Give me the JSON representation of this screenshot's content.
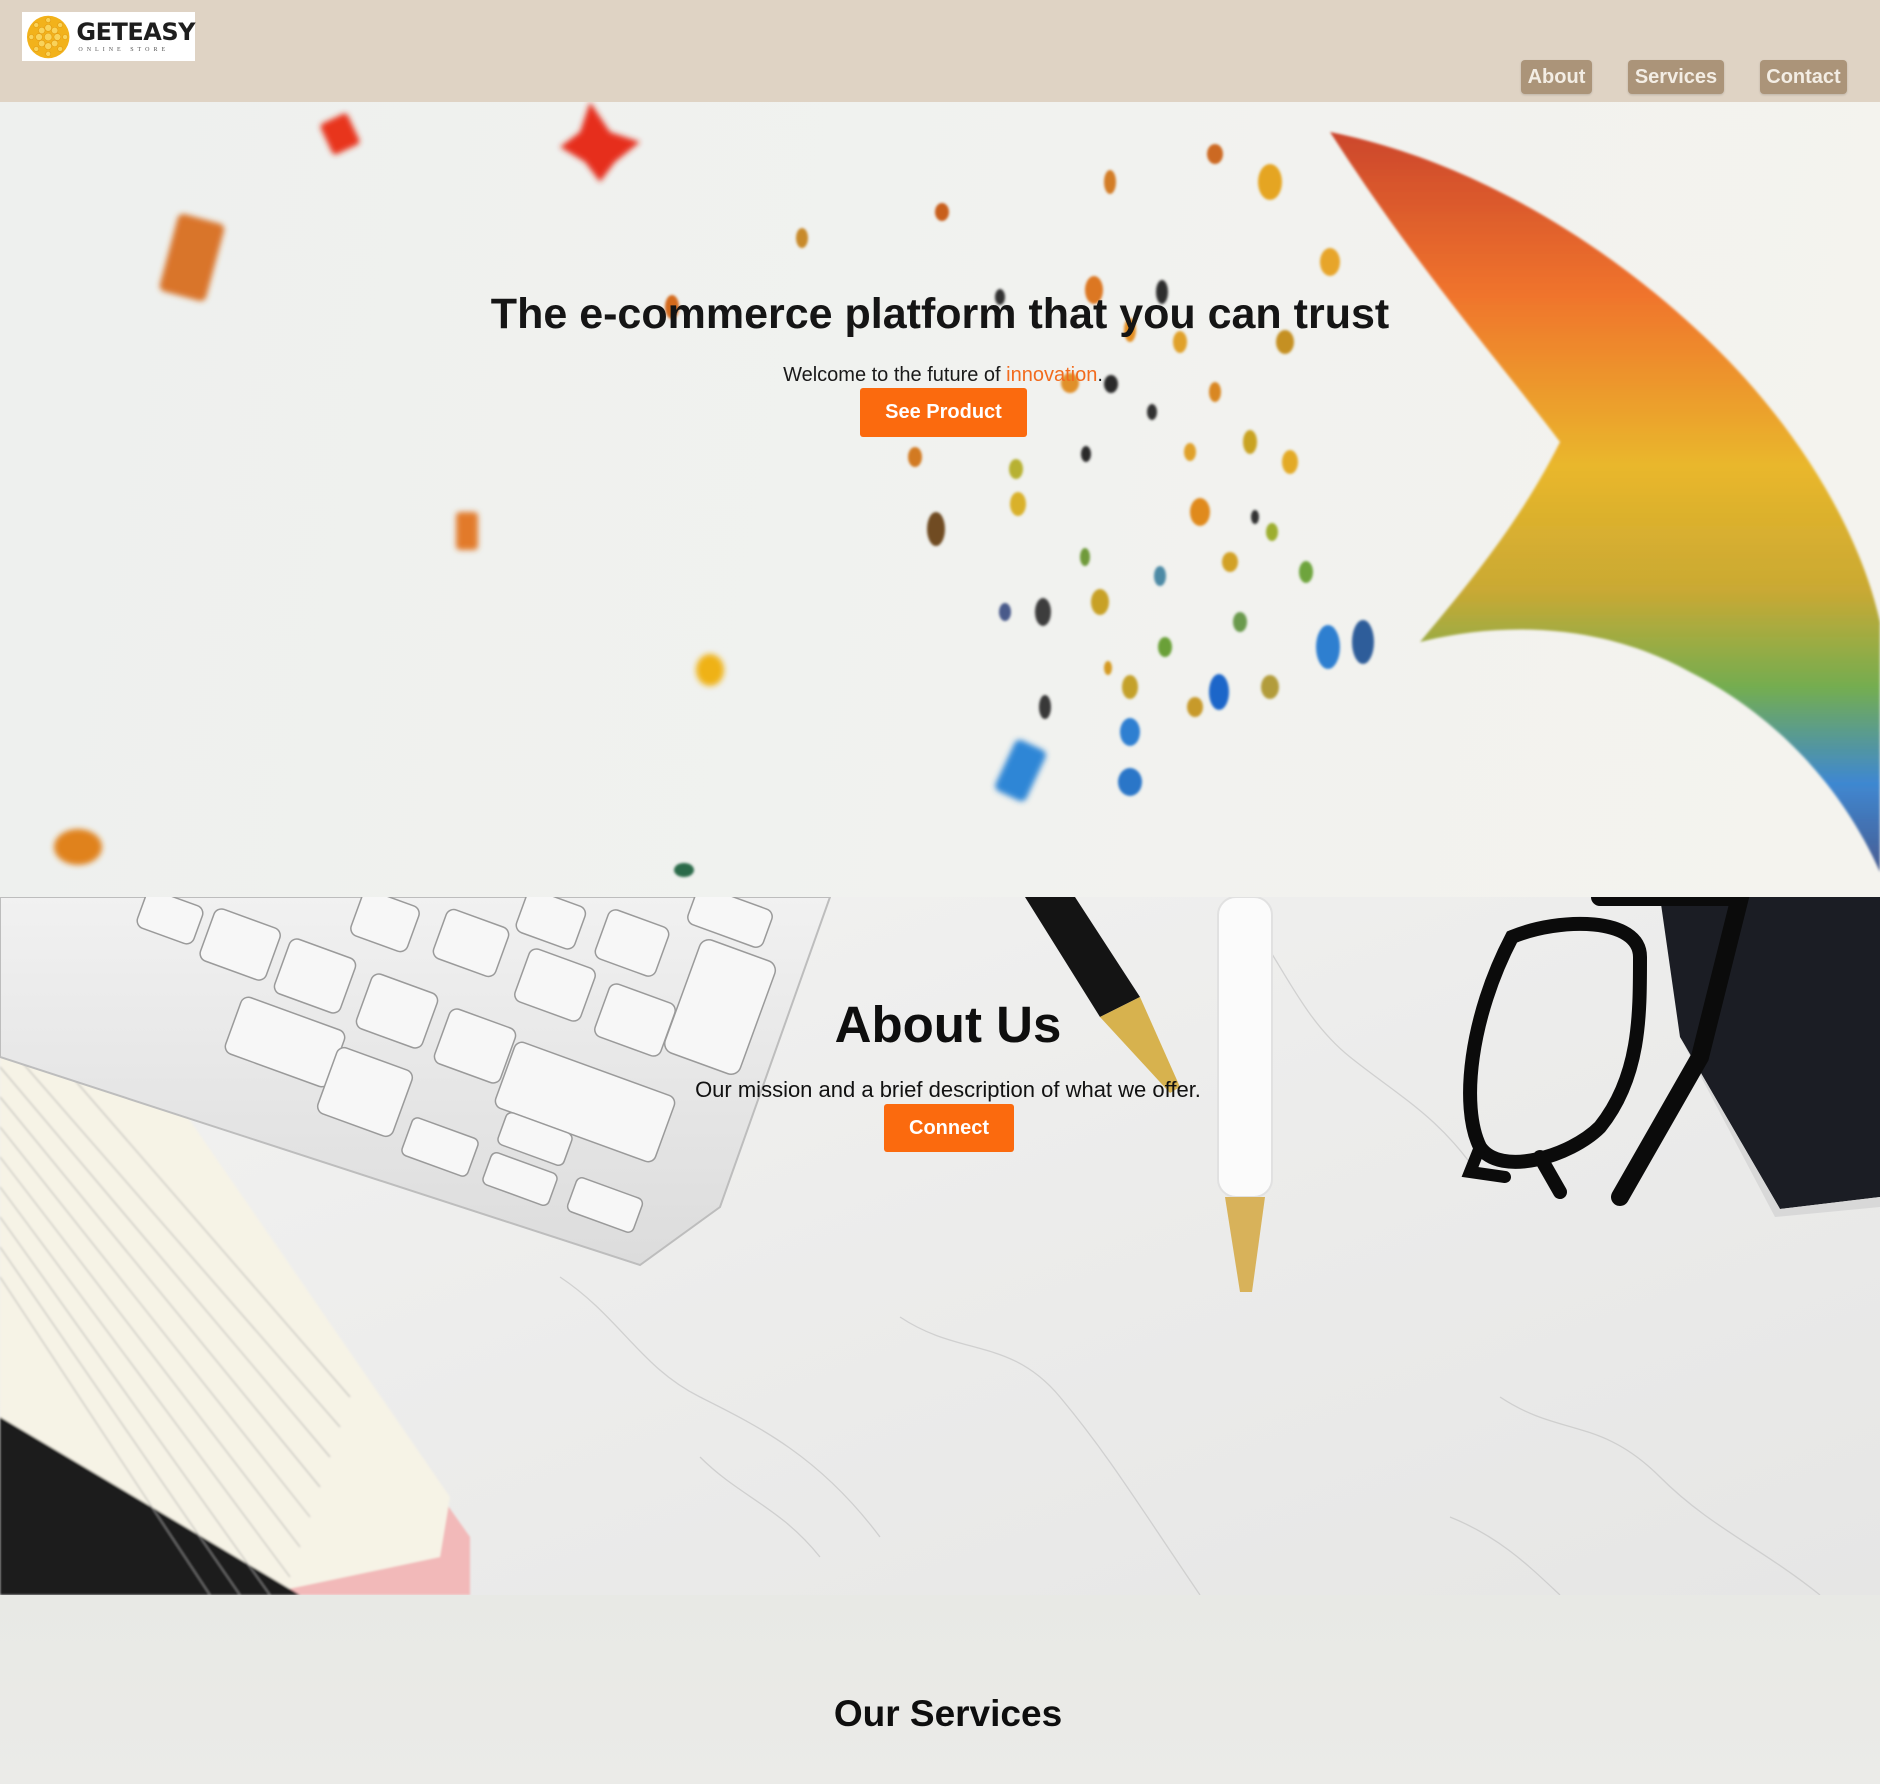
{
  "header": {
    "logo": {
      "name": "GETEASY",
      "tagline": "ONLINE STORE",
      "icon": "sun-flower-logo-icon"
    },
    "nav": [
      {
        "label": "About"
      },
      {
        "label": "Services"
      },
      {
        "label": "Contact"
      }
    ]
  },
  "hero": {
    "title": "The e-commerce platform that you can trust",
    "subtitle_before": "Welcome to the future of ",
    "subtitle_accent": "innovation",
    "subtitle_after": ".",
    "cta_label": "See Product",
    "background": "colorful-confetti-wave-photo"
  },
  "about": {
    "title": "About Us",
    "subtitle": "Our mission and a brief description of what we offer.",
    "cta_label": "Connect",
    "background": "desk-flatlay-photo"
  },
  "services": {
    "title": "Our Services"
  },
  "colors": {
    "header_bg": "#dfd3c4",
    "nav_button_bg": "#ab9479",
    "accent": "#fb6a0e",
    "accent_text": "#f26b1d"
  }
}
